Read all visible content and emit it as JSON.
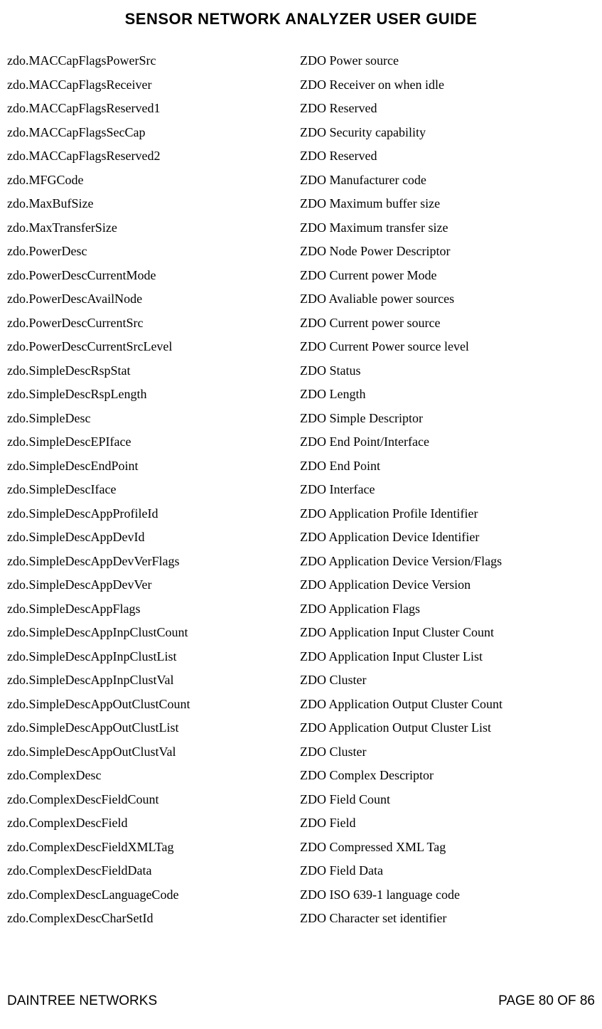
{
  "header": "SENSOR NETWORK ANALYZER USER GUIDE",
  "footer": {
    "left": "DAINTREE NETWORKS",
    "right": "PAGE 80 OF 86"
  },
  "rows": [
    {
      "left": "zdo.MACCapFlagsPowerSrc",
      "right": "ZDO Power source"
    },
    {
      "left": "zdo.MACCapFlagsReceiver",
      "right": "ZDO Receiver on when idle"
    },
    {
      "left": "zdo.MACCapFlagsReserved1",
      "right": "ZDO Reserved"
    },
    {
      "left": "zdo.MACCapFlagsSecCap",
      "right": "ZDO Security capability"
    },
    {
      "left": "zdo.MACCapFlagsReserved2",
      "right": "ZDO Reserved"
    },
    {
      "left": "zdo.MFGCode",
      "right": "ZDO Manufacturer code"
    },
    {
      "left": "zdo.MaxBufSize",
      "right": "ZDO Maximum buffer size"
    },
    {
      "left": "zdo.MaxTransferSize",
      "right": "ZDO Maximum transfer size"
    },
    {
      "left": "zdo.PowerDesc",
      "right": "ZDO Node Power Descriptor"
    },
    {
      "left": "zdo.PowerDescCurrentMode",
      "right": "ZDO Current power Mode"
    },
    {
      "left": "zdo.PowerDescAvailNode",
      "right": "ZDO Avaliable power sources"
    },
    {
      "left": "zdo.PowerDescCurrentSrc",
      "right": "ZDO Current power source"
    },
    {
      "left": "zdo.PowerDescCurrentSrcLevel",
      "right": "ZDO Current Power source level"
    },
    {
      "left": "zdo.SimpleDescRspStat",
      "right": "ZDO Status"
    },
    {
      "left": "zdo.SimpleDescRspLength",
      "right": "ZDO Length"
    },
    {
      "left": "zdo.SimpleDesc",
      "right": "ZDO Simple Descriptor"
    },
    {
      "left": "zdo.SimpleDescEPIface",
      "right": "ZDO End Point/Interface"
    },
    {
      "left": "zdo.SimpleDescEndPoint",
      "right": "ZDO End Point"
    },
    {
      "left": "zdo.SimpleDescIface",
      "right": "ZDO Interface"
    },
    {
      "left": "zdo.SimpleDescAppProfileId",
      "right": "ZDO Application Profile Identifier"
    },
    {
      "left": "zdo.SimpleDescAppDevId",
      "right": "ZDO Application Device Identifier"
    },
    {
      "left": "zdo.SimpleDescAppDevVerFlags",
      "right": "ZDO Application Device Version/Flags"
    },
    {
      "left": "zdo.SimpleDescAppDevVer",
      "right": "ZDO Application Device Version"
    },
    {
      "left": "zdo.SimpleDescAppFlags",
      "right": "ZDO Application Flags"
    },
    {
      "left": "zdo.SimpleDescAppInpClustCount",
      "right": "ZDO Application Input Cluster Count"
    },
    {
      "left": "zdo.SimpleDescAppInpClustList",
      "right": "ZDO Application Input Cluster List"
    },
    {
      "left": "zdo.SimpleDescAppInpClustVal",
      "right": "ZDO Cluster"
    },
    {
      "left": "zdo.SimpleDescAppOutClustCount",
      "right": "ZDO Application Output Cluster Count"
    },
    {
      "left": "zdo.SimpleDescAppOutClustList",
      "right": "ZDO Application Output Cluster List"
    },
    {
      "left": "zdo.SimpleDescAppOutClustVal",
      "right": "ZDO Cluster"
    },
    {
      "left": "zdo.ComplexDesc",
      "right": "ZDO Complex Descriptor"
    },
    {
      "left": "zdo.ComplexDescFieldCount",
      "right": "ZDO Field Count"
    },
    {
      "left": "zdo.ComplexDescField",
      "right": "ZDO Field"
    },
    {
      "left": "zdo.ComplexDescFieldXMLTag",
      "right": "ZDO Compressed XML Tag"
    },
    {
      "left": "zdo.ComplexDescFieldData",
      "right": "ZDO Field Data"
    },
    {
      "left": "zdo.ComplexDescLanguageCode",
      "right": "ZDO ISO 639-1 language code"
    },
    {
      "left": "zdo.ComplexDescCharSetId",
      "right": "ZDO Character set identifier"
    }
  ]
}
